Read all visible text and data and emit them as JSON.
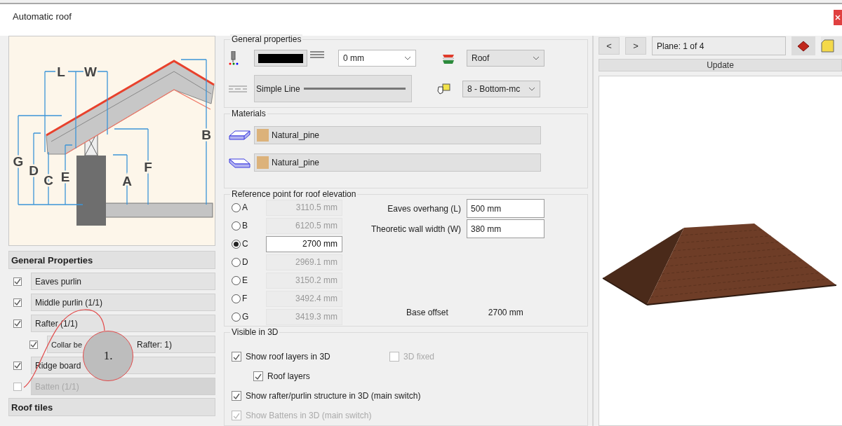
{
  "window": {
    "title": "Automatic roof"
  },
  "diagram": {
    "labels": [
      "L",
      "W",
      "B",
      "G",
      "D",
      "C",
      "E",
      "F",
      "A"
    ]
  },
  "sections": [
    {
      "label": "General Properties",
      "items": [
        {
          "label": "Eaves purlin",
          "checked": true,
          "disabled": false
        },
        {
          "label": "Middle purlin (1/1)",
          "checked": true,
          "disabled": false
        },
        {
          "label": "Rafter (1/1)",
          "checked": true,
          "disabled": false,
          "children": [
            {
              "label": "Collar be",
              "label_2": "Rafter: 1)",
              "checked": true,
              "disabled": false
            }
          ]
        },
        {
          "label": "Ridge board",
          "checked": true,
          "disabled": false
        },
        {
          "label": "Batten (1/1)",
          "checked": false,
          "disabled": true
        }
      ]
    },
    {
      "label": "Roof tiles"
    }
  ],
  "callout": {
    "label": "1."
  },
  "general_properties": {
    "title": "General properties",
    "thickness": "0 mm",
    "layer": "Roof",
    "line_type": "Simple Line",
    "draw_order": "8 - Bottom-mc"
  },
  "materials": {
    "title": "Materials",
    "items": [
      {
        "kind": "top",
        "name": "Natural_pine"
      },
      {
        "kind": "bottom",
        "name": "Natural_pine"
      }
    ]
  },
  "reference": {
    "title": "Reference point for roof elevation",
    "points": [
      {
        "label": "A",
        "value": "3110.5 mm",
        "selected": false
      },
      {
        "label": "B",
        "value": "6120.5 mm",
        "selected": false
      },
      {
        "label": "C",
        "value": "2700 mm",
        "selected": true
      },
      {
        "label": "D",
        "value": "2969.1 mm",
        "selected": false
      },
      {
        "label": "E",
        "value": "3150.2 mm",
        "selected": false
      },
      {
        "label": "F",
        "value": "3492.4 mm",
        "selected": false
      },
      {
        "label": "G",
        "value": "3419.3 mm",
        "selected": false
      }
    ],
    "fields": [
      {
        "label": "Eaves overhang (L)",
        "value": "500 mm"
      },
      {
        "label": "Theoretic wall width (W)",
        "value": "380 mm"
      }
    ],
    "base_offset": {
      "label": "Base offset",
      "value": "2700 mm"
    }
  },
  "visible_3d": {
    "title": "Visible in 3D",
    "options": [
      {
        "kind": "main",
        "label": "Show roof layers in 3D",
        "checked": true,
        "disabled": false
      },
      {
        "kind": "side",
        "label": "3D fixed",
        "checked": false,
        "disabled": true
      },
      {
        "kind": "sub",
        "label": "Roof layers",
        "checked": true,
        "disabled": false
      },
      {
        "kind": "main",
        "label": "Show rafter/purlin structure in 3D (main switch)",
        "checked": true,
        "disabled": false
      },
      {
        "kind": "main",
        "label": "Show Battens in 3D (main switch)",
        "checked": true,
        "disabled": true
      }
    ]
  },
  "viewer": {
    "prev": "<",
    "next": ">",
    "plane": "Plane: 1 of 4",
    "update": "Update"
  }
}
